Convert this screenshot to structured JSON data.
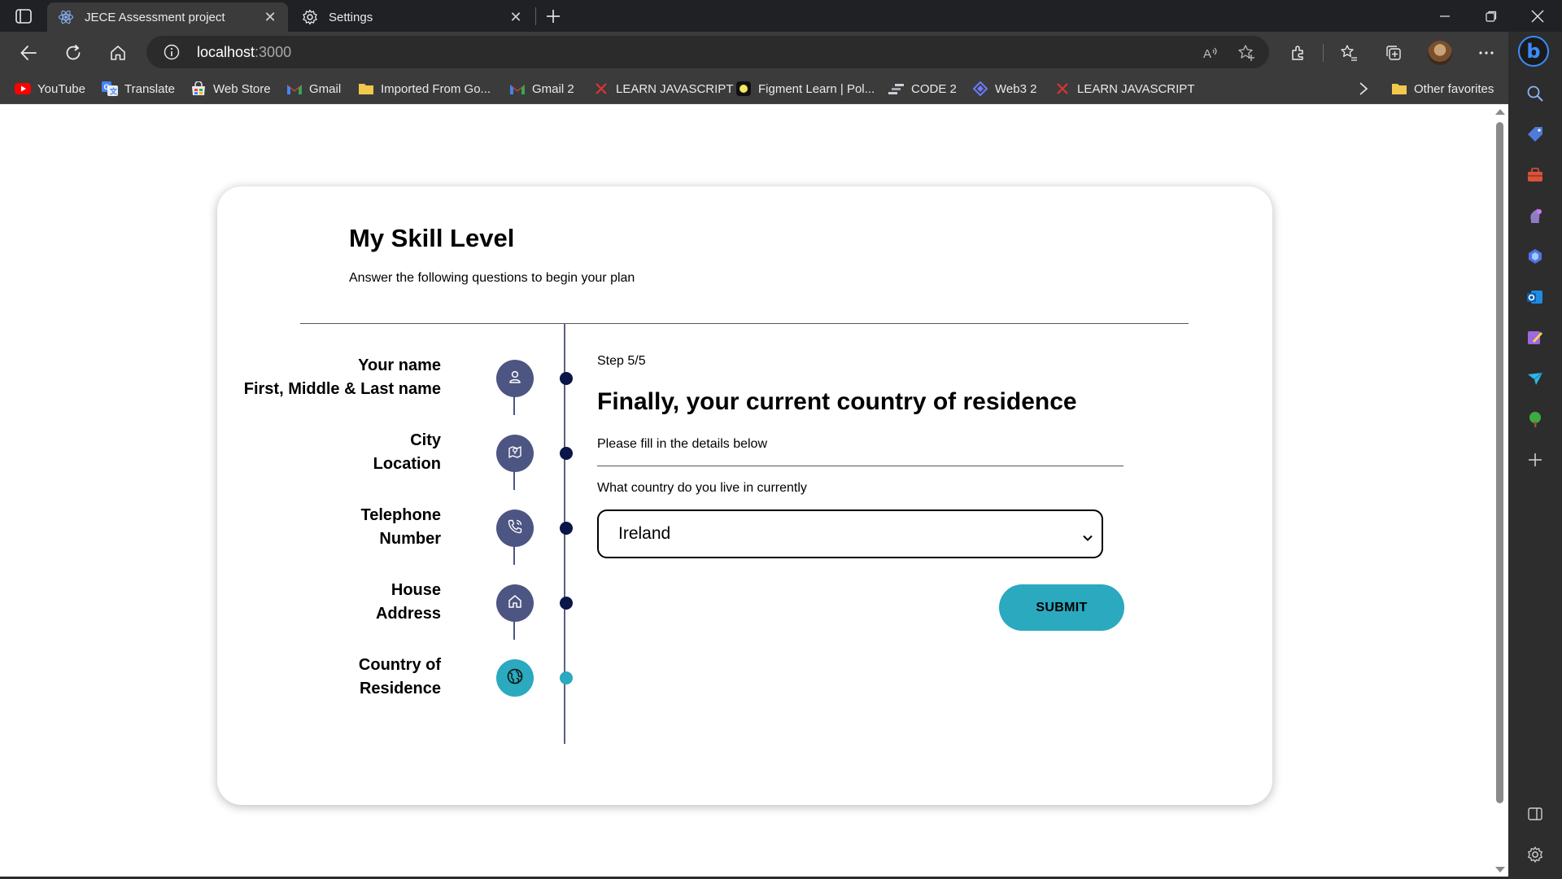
{
  "browser": {
    "tabs": [
      {
        "title": "JECE Assessment project",
        "favicon": "react-icon",
        "active": true
      },
      {
        "title": "Settings",
        "favicon": "gear-icon",
        "active": false
      }
    ],
    "address": {
      "host": "localhost",
      "port": ":3000"
    },
    "bookmarks": [
      {
        "label": "YouTube",
        "icon": "youtube-icon",
        "color": "#ff0000"
      },
      {
        "label": "Translate",
        "icon": "translate-icon",
        "color": "#4285f4"
      },
      {
        "label": "Web Store",
        "icon": "web-store-icon",
        "color": "#34a853"
      },
      {
        "label": "Gmail",
        "icon": "gmail-icon",
        "color": "#ea4335"
      },
      {
        "label": "Imported From Go...",
        "icon": "folder-icon",
        "color": "#f2c94c"
      },
      {
        "label": "Gmail 2",
        "icon": "gmail-icon",
        "color": "#ea4335"
      },
      {
        "label": "LEARN JAVASCRIPT",
        "icon": "x-icon",
        "color": "#d33"
      },
      {
        "label": "Figment Learn | Pol...",
        "icon": "figment-icon",
        "color": "#f5e663"
      },
      {
        "label": "CODE 2",
        "icon": "code-icon",
        "color": "#cfcfcf"
      },
      {
        "label": "Web3 2",
        "icon": "web3-icon",
        "color": "#6c7bff"
      },
      {
        "label": "LEARN JAVASCRIPT",
        "icon": "x-icon",
        "color": "#d33"
      }
    ],
    "other_favorites": "Other favorites"
  },
  "page": {
    "title": "My Skill Level",
    "subtitle": "Answer the following questions to begin your plan"
  },
  "steps": [
    {
      "line1": "Your name",
      "line2": "First, Middle & Last name",
      "icon": "user-icon",
      "current": false
    },
    {
      "line1": "City",
      "line2": "Location",
      "icon": "map-pin-icon",
      "current": false
    },
    {
      "line1": "Telephone",
      "line2": "Number",
      "icon": "phone-icon",
      "current": false
    },
    {
      "line1": "House",
      "line2": "Address",
      "icon": "home-icon",
      "current": false
    },
    {
      "line1": "Country of",
      "line2": "Residence",
      "icon": "globe-icon",
      "current": true
    }
  ],
  "form": {
    "step_indicator": "Step 5/5",
    "title": "Finally, your current country of residence",
    "hint": "Please fill in the details below",
    "country_label": "What country do you live in currently",
    "country_value": "Ireland",
    "submit_label": "SUBMIT"
  },
  "colors": {
    "accent": "#2aa9bf",
    "step_circle": "#4d5583",
    "step_dot": "#0b1548"
  }
}
